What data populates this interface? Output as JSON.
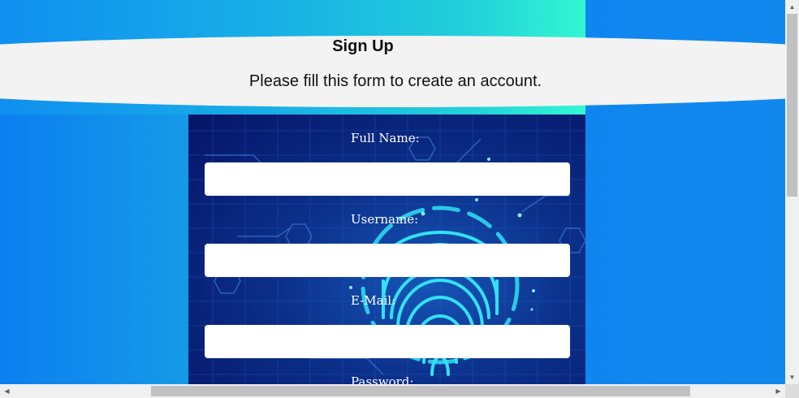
{
  "header": {
    "title": "Sign Up",
    "subtitle": "Please fill this form to create an account."
  },
  "form": {
    "fields": [
      {
        "label": "Full Name:",
        "value": ""
      },
      {
        "label": "Username:",
        "value": ""
      },
      {
        "label": "E-Mail:",
        "value": ""
      },
      {
        "label": "Password:",
        "value": ""
      }
    ]
  },
  "icons": {
    "background_art": "fingerprint-icon",
    "scroll_up": "arrow-up-icon",
    "scroll_down": "arrow-down-icon",
    "scroll_left": "arrow-left-icon",
    "scroll_right": "arrow-right-icon"
  },
  "colors": {
    "page_background": "#1188ee",
    "header_band": "#f3f3f3",
    "panel_background": "#0b2f88",
    "accent_cyan": "#2fd8f0"
  }
}
